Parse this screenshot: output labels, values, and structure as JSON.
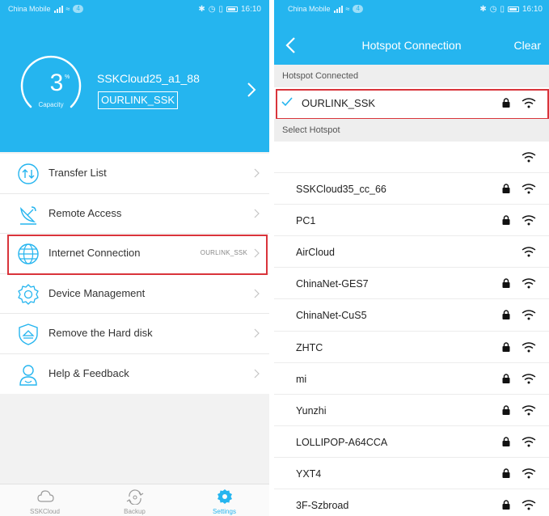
{
  "status_bar": {
    "carrier": "China Mobile",
    "time": "16:10",
    "badge": "4",
    "extra": "G"
  },
  "left": {
    "capacity": {
      "value": "3",
      "unit": "%",
      "label": "Capacity"
    },
    "device_name": "SSKCloud25_a1_88",
    "connected_ssid": "OURLINK_SSK",
    "menu": [
      {
        "label": "Transfer List",
        "icon": "transfer-icon",
        "value": ""
      },
      {
        "label": "Remote Access",
        "icon": "satellite-dish-icon",
        "value": ""
      },
      {
        "label": "Internet Connection",
        "icon": "globe-icon",
        "value": "OURLINK_SSK"
      },
      {
        "label": "Device Management",
        "icon": "gear-icon",
        "value": ""
      },
      {
        "label": "Remove the Hard disk",
        "icon": "eject-shield-icon",
        "value": ""
      },
      {
        "label": "Help & Feedback",
        "icon": "person-help-icon",
        "value": ""
      }
    ],
    "tabs": [
      {
        "label": "SSKCloud",
        "icon": "cloud-icon"
      },
      {
        "label": "Backup",
        "icon": "backup-icon"
      },
      {
        "label": "Settings",
        "icon": "settings-icon"
      }
    ],
    "active_tab": "Settings"
  },
  "right": {
    "title": "Hotspot Connection",
    "clear_label": "Clear",
    "section_connected": "Hotspot Connected",
    "connected": {
      "ssid": "OURLINK_SSK",
      "locked": true
    },
    "section_select": "Select Hotspot",
    "hotspots": [
      {
        "ssid": "",
        "locked": false
      },
      {
        "ssid": "SSKCloud35_cc_66",
        "locked": true
      },
      {
        "ssid": "PC1",
        "locked": true
      },
      {
        "ssid": "AirCloud",
        "locked": false
      },
      {
        "ssid": "ChinaNet-GES7",
        "locked": true
      },
      {
        "ssid": "ChinaNet-CuS5",
        "locked": true
      },
      {
        "ssid": "ZHTC",
        "locked": true
      },
      {
        "ssid": "mi",
        "locked": true
      },
      {
        "ssid": "Yunzhi",
        "locked": true
      },
      {
        "ssid": "LOLLIPOP-A64CCA",
        "locked": true
      },
      {
        "ssid": "YXT4",
        "locked": true
      },
      {
        "ssid": "3F-Szbroad",
        "locked": true
      }
    ]
  },
  "colors": {
    "brand": "#25b5ef",
    "highlight": "#d9343b"
  }
}
